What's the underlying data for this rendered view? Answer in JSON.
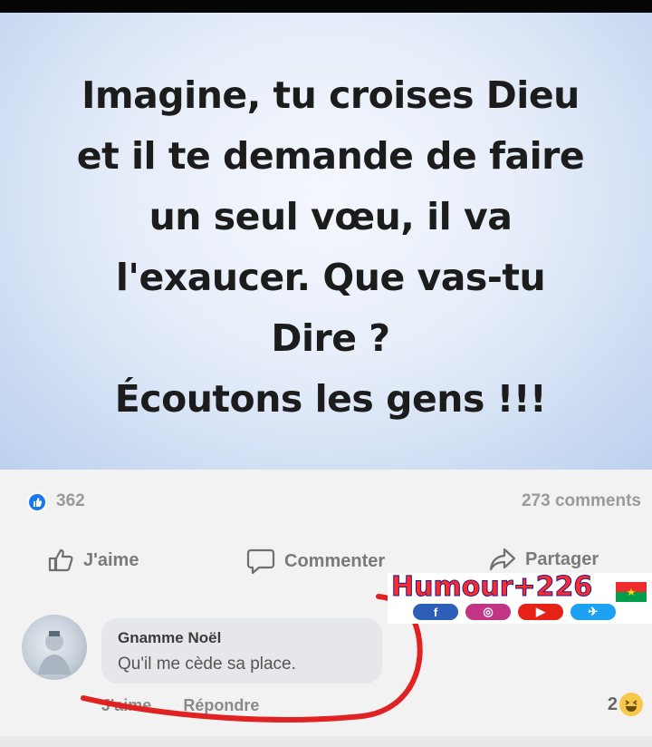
{
  "post": {
    "text": "Imagine, tu croises Dieu\net il te demande de faire\nun seul vœu, il va\nl'exaucer. Que vas-tu\nDire ?\nÉcoutons les gens !!!"
  },
  "stats": {
    "likes": "362",
    "comments": "273 comments"
  },
  "actions": {
    "like_label": "J'aime",
    "comment_label": "Commenter",
    "share_label": "Partager"
  },
  "comment": {
    "author": "Gnamme Noël",
    "text": "Qu'il me cède sa place.",
    "like_action": "J'aime",
    "reply_action": "Répondre",
    "reaction_count": "2"
  },
  "watermark": {
    "text": "Humour+226",
    "socials": [
      "facebook-icon",
      "instagram-icon",
      "youtube-icon",
      "twitter-icon"
    ]
  },
  "colors": {
    "facebook_blue": "#1a77f2",
    "annotation_red": "#e02222",
    "watermark_red": "#ff2a2a"
  }
}
